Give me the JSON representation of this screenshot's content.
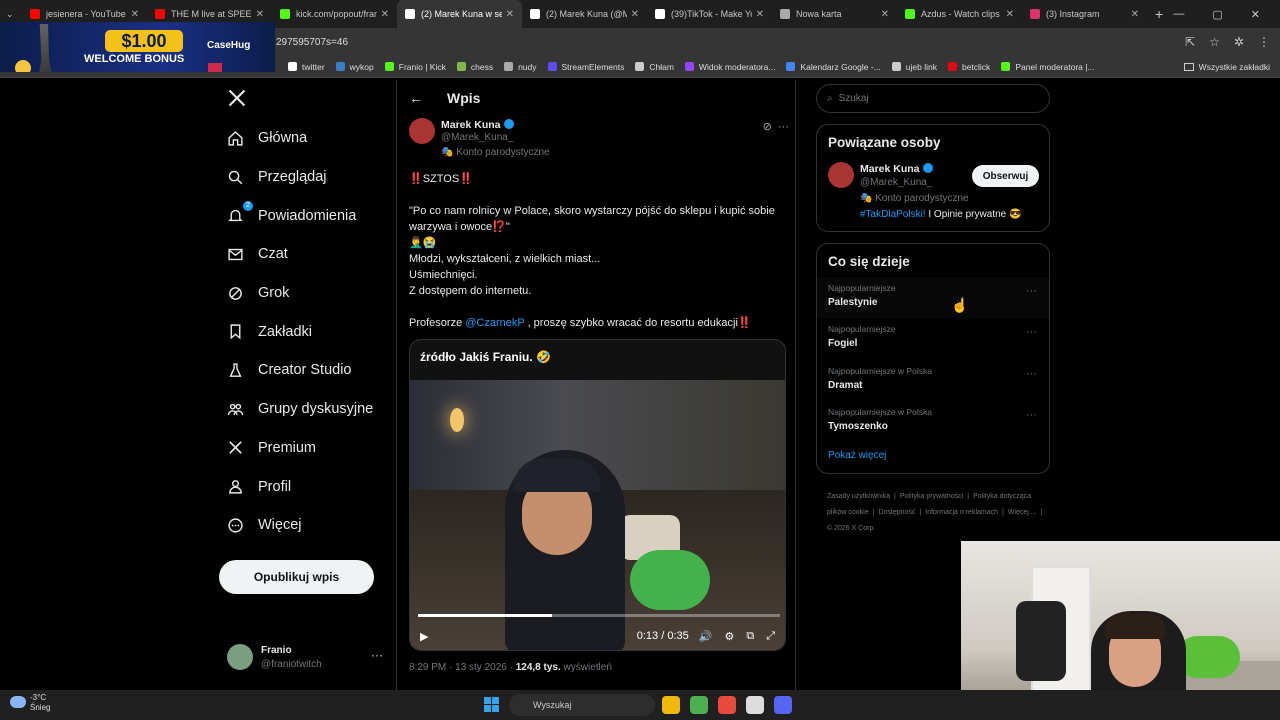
{
  "browser": {
    "tabs": [
      {
        "title": "jesienera - YouTube",
        "color": "#ff0000"
      },
      {
        "title": "THE M live at SPEEDL",
        "color": "#ff0000"
      },
      {
        "title": "kick.com/popout/fran",
        "color": "#53fc18"
      },
      {
        "title": "(2) Marek Kuna w ser",
        "color": "#ffffff",
        "active": true
      },
      {
        "title": "(2) Marek Kuna (@M",
        "color": "#ffffff"
      },
      {
        "title": "(39)TikTok - Make Yo",
        "color": "#ffffff"
      },
      {
        "title": "Nowa karta",
        "color": "#aaaaaa"
      },
      {
        "title": "Azdus - Watch clips",
        "color": "#53fc18"
      },
      {
        "title": "(3) Instagram",
        "color": "#e1306c"
      }
    ],
    "url": "297595707s=46",
    "bookmarks": [
      {
        "label": "twitter",
        "color": "#ffffff"
      },
      {
        "label": "wykop",
        "color": "#3c7ec6"
      },
      {
        "label": "Franio | Kick",
        "color": "#53fc18"
      },
      {
        "label": "chess",
        "color": "#81b64c"
      },
      {
        "label": "nudy",
        "color": "#aaaaaa"
      },
      {
        "label": "StreamElements",
        "color": "#5b4df0"
      },
      {
        "label": "Chłam",
        "color": "#cccccc"
      },
      {
        "label": "Widok moderatora...",
        "color": "#9146ff"
      },
      {
        "label": "Kalendarz Google -...",
        "color": "#4285f4"
      },
      {
        "label": "ujeb link",
        "color": "#cccccc"
      },
      {
        "label": "betclick",
        "color": "#e30613"
      },
      {
        "label": "Panel moderatora |...",
        "color": "#53fc18"
      }
    ],
    "all_bookmarks": "Wszystkie zakładki"
  },
  "ad": {
    "amount": "$1.00",
    "text": "WELCOME BONUS",
    "brand": "CaseHug"
  },
  "nav": {
    "items": [
      {
        "label": "Główna",
        "icon": "home-icon"
      },
      {
        "label": "Przeglądaj",
        "icon": "search-icon"
      },
      {
        "label": "Powiadomienia",
        "icon": "bell-icon",
        "badge": "2"
      },
      {
        "label": "Czat",
        "icon": "mail-icon"
      },
      {
        "label": "Grok",
        "icon": "grok-icon"
      },
      {
        "label": "Zakładki",
        "icon": "bookmark-icon"
      },
      {
        "label": "Creator Studio",
        "icon": "flask-icon"
      },
      {
        "label": "Grupy dyskusyjne",
        "icon": "people-icon"
      },
      {
        "label": "Premium",
        "icon": "x-icon"
      },
      {
        "label": "Profil",
        "icon": "person-icon"
      },
      {
        "label": "Więcej",
        "icon": "more-icon"
      }
    ],
    "post_button": "Opublikuj wpis",
    "account": {
      "name": "Franio",
      "handle": "@franiotwitch"
    }
  },
  "post": {
    "header": "Wpis",
    "author": {
      "name": "Marek Kuna",
      "handle": "@Marek_Kuna_",
      "parody": "Konto parodystyczne"
    },
    "lines": [
      "‼️SZTOS‼️",
      "\"Po co nam rolnicy w Polace, skoro wystarczy pójść do sklepu i kupić sobie warzywa i owoce⁉️\"",
      "🤦‍♂️😭",
      "Młodzi, wykształceni, z wielkich miast...",
      "Uśmiechnięci.",
      "Z dostępem do internetu."
    ],
    "mention_pre": "Profesorze ",
    "mention": "@CzarnekP",
    "mention_post": " , proszę szybko wracać do resortu edukacji‼️",
    "video": {
      "caption": "źródło Jakiś Franiu. 🤣",
      "time": "0:13 / 0:35",
      "progress": 0.37
    },
    "meta_time": "8:29 PM · 13 sty 2026 · ",
    "views": "124,8 tys.",
    "views_label": " wyświetleń"
  },
  "sidebar": {
    "search_placeholder": "Szukaj",
    "related_title": "Powiązane osoby",
    "related": {
      "name": "Marek Kuna",
      "handle": "@Marek_Kuna_",
      "parody": "Konto parodystyczne",
      "bio_link": "#TakDlaPolski!",
      "bio_rest": " I Opinie prywatne 😎",
      "follow": "Obserwuj"
    },
    "trends_title": "Co się dzieje",
    "trends": [
      {
        "cat": "Najpopularniejsze",
        "topic": "Palestynie"
      },
      {
        "cat": "Najpopularniejsze",
        "topic": "Fogiel"
      },
      {
        "cat": "Najpopularniejsze w Polska",
        "topic": "Dramat"
      },
      {
        "cat": "Najpopularniejsze w Polska",
        "topic": "Tymoszenko"
      }
    ],
    "show_more": "Pokaż więcej",
    "footer": [
      "Zasady użytkownika",
      "Polityka prywatności",
      "Polityka dotycząca plików cookie",
      "Dostępność",
      "Informacja o reklamach",
      "Więcej ...",
      "© 2026 X Corp."
    ]
  },
  "taskbar": {
    "temp": "-3°C",
    "weather": "Śnieg",
    "search": "Wyszukaj"
  }
}
